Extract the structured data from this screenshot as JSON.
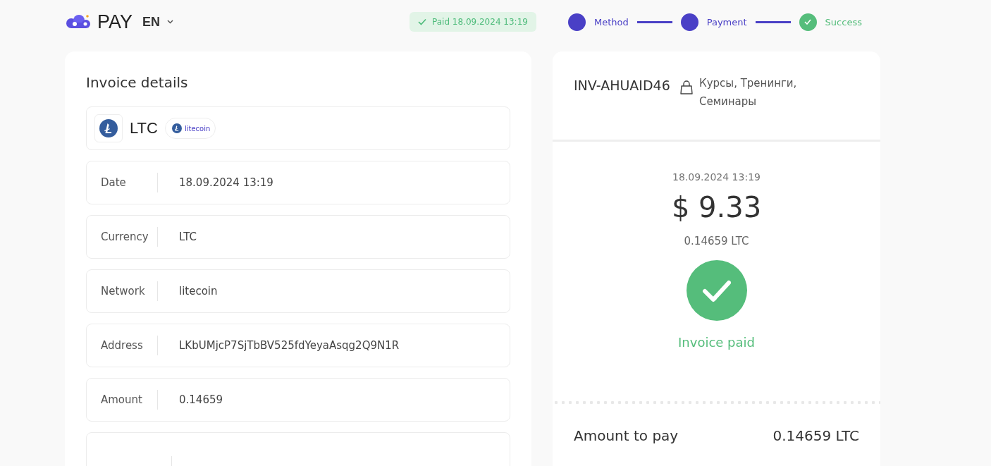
{
  "header": {
    "logo_text": "PAY",
    "language": "EN",
    "paid_badge": "Paid 18.09.2024 13:19"
  },
  "steps": [
    {
      "label": "Method",
      "kind": "filled"
    },
    {
      "label": "Payment",
      "kind": "filled"
    },
    {
      "label": "Success",
      "kind": "check"
    }
  ],
  "invoice_details": {
    "title": "Invoice details",
    "coin": {
      "ticker": "LTC",
      "network_tag": "litecoin"
    },
    "rows": [
      {
        "label": "Date",
        "value": "18.09.2024 13:19"
      },
      {
        "label": "Currency",
        "value": "LTC"
      },
      {
        "label": "Network",
        "value": "litecoin"
      },
      {
        "label": "Address",
        "value": "LKbUMjcP7SjTbBV525fdYeyaAsqg2Q9N1R"
      },
      {
        "label": "Amount",
        "value": "0.14659"
      }
    ],
    "partial_row": true
  },
  "summary": {
    "invoice_id": "INV-AHUAID46",
    "category": "Курсы, Тренинги, Семинары",
    "date": "18.09.2024 13:19",
    "amount_usd": "$ 9.33",
    "amount_crypto": "0.14659 LTC",
    "status": "Invoice paid",
    "total_label": "Amount to pay",
    "total_value": "0.14659 LTC"
  }
}
